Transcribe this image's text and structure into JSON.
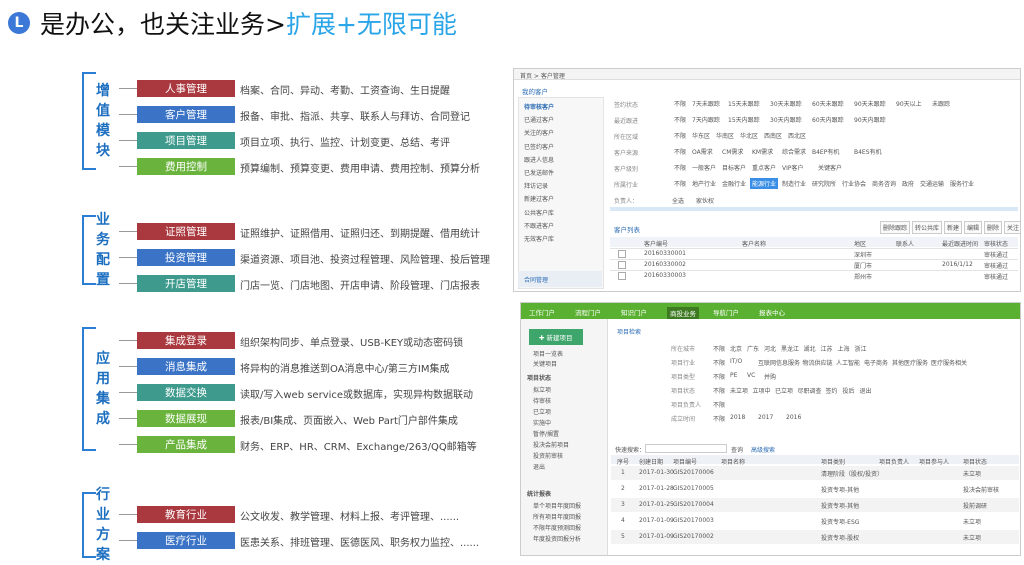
{
  "header": {
    "badge": "L",
    "title_black": "是办公，也关注业务>",
    "title_blue": "扩展+无限可能"
  },
  "groups": [
    {
      "label": "增值模块",
      "items": [
        {
          "tag": "人事管理",
          "color": "c-red",
          "desc": "档案、合同、异动、考勤、工资查询、生日提醒"
        },
        {
          "tag": "客户管理",
          "color": "c-blue",
          "desc": "报备、审批、指派、共享、联系人与拜访、合同登记"
        },
        {
          "tag": "项目管理",
          "color": "c-teal",
          "desc": "项目立项、执行、监控、计划变更、总结、考评"
        },
        {
          "tag": "费用控制",
          "color": "c-green",
          "desc": "预算编制、预算变更、费用申请、费用控制、预算分析"
        }
      ]
    },
    {
      "label": "业务配置",
      "items": [
        {
          "tag": "证照管理",
          "color": "c-red",
          "desc": "证照维护、证照借用、证照归还、到期提醒、借用统计"
        },
        {
          "tag": "投资管理",
          "color": "c-blue",
          "desc": "渠道资源、项目池、投资过程管理、风险管理、投后管理"
        },
        {
          "tag": "开店管理",
          "color": "c-teal",
          "desc": "门店一览、门店地图、开店申请、阶段管理、门店报表"
        }
      ]
    },
    {
      "label": "应用集成",
      "items": [
        {
          "tag": "集成登录",
          "color": "c-red",
          "desc": "组织架构同步、单点登录、USB-KEY或动态密码锁"
        },
        {
          "tag": "消息集成",
          "color": "c-blue",
          "desc": "将异构的消息推送到OA消息中心/第三方IM集成"
        },
        {
          "tag": "数据交换",
          "color": "c-teal",
          "desc": "读取/写入web service或数据库，实现异构数据联动"
        },
        {
          "tag": "数据展现",
          "color": "c-green",
          "desc": "报表/BI集成、页面嵌入、Web Part门户部件集成"
        },
        {
          "tag": "产品集成",
          "color": "c-green",
          "desc": "财务、ERP、HR、CRM、Exchange/263/QQ邮箱等"
        }
      ]
    },
    {
      "label": "行业方案",
      "items": [
        {
          "tag": "教育行业",
          "color": "c-red",
          "desc": "公文收发、教学管理、材料上报、考评管理、......"
        },
        {
          "tag": "医疗行业",
          "color": "c-blue",
          "desc": "医患关系、排班管理、医德医风、职务权力监控、......"
        }
      ]
    }
  ],
  "shot1": {
    "breadcrumb": "首页 > 客户管理",
    "side_title": "我的客户",
    "side_items": [
      "待审核客户",
      "已通过客户",
      "关注的客户",
      "已签约客户",
      "跟进人信息",
      "已发送邮件",
      "拜访记录",
      "新建过客户",
      "公共客户库",
      "不跟进客户",
      "无效客户库"
    ],
    "side_footer": "合同管理",
    "filters": [
      {
        "label": "签约状态",
        "opts": [
          "不限",
          "7天未跟踪",
          "15天未跟踪",
          "30天未跟踪",
          "60天未跟踪",
          "90天未跟踪",
          "90天以上",
          "未跟踪"
        ]
      },
      {
        "label": "最近跟进",
        "opts": [
          "不限",
          "7天内跟踪",
          "15天内跟踪",
          "30天内跟踪",
          "60天内跟踪",
          "90天内跟踪"
        ]
      },
      {
        "label": "所在区域",
        "opts": [
          "不限",
          "华东区",
          "华南区",
          "华北区",
          "西南区",
          "西北区"
        ]
      },
      {
        "label": "客户来源",
        "opts": [
          "不限",
          "OA需求",
          "CM需求",
          "KM需求",
          "综合需求",
          "B4EP有机",
          "B4ES有机"
        ]
      },
      {
        "label": "客户级别",
        "opts": [
          "不限",
          "一般客户",
          "目标客户",
          "重点客户",
          "VIP客户",
          "关键客户"
        ]
      },
      {
        "label": "所属行业",
        "opts": [
          "不限",
          "地产行业",
          "金融行业",
          "能源行业",
          "制造行业",
          "研究院所",
          "行业协会",
          "商务咨询",
          "政府",
          "交通运输",
          "服务行业"
        ]
      }
    ],
    "owner_label": "负责人：",
    "chk1": "全选",
    "chk2": "家伙权",
    "list_title": "客户列表",
    "actions": [
      "删除跟踪",
      "转公共库",
      "新建",
      "编辑",
      "删除",
      "关注"
    ],
    "columns": [
      "",
      "客户编号",
      "客户名称",
      "地区",
      "联系人",
      "最近跟进时间",
      "审核状态"
    ],
    "rows": [
      {
        "id": "20160330001",
        "area": "深圳市",
        "date": "",
        "status": "审核通过"
      },
      {
        "id": "20160330002",
        "area": "厦门市",
        "date": "2016/1/12",
        "status": "审核通过"
      },
      {
        "id": "20160330003",
        "area": "郑州市",
        "date": "",
        "status": "审核通过"
      }
    ]
  },
  "shot2": {
    "tabs": [
      "工作门户",
      "流程门户",
      "知识门户",
      "商投业务",
      "导航门户",
      "报表中心"
    ],
    "new_btn": "✚ 新建项目",
    "side_a": [
      "项目一览表",
      "关键项目"
    ],
    "side_b_title": "项目状态",
    "side_b": [
      "拟立项",
      "待审核",
      "已立项",
      "实施中",
      "暂停/搁置",
      "投决会前项目",
      "投资前审核",
      "退出"
    ],
    "side_c_title": "统计报表",
    "side_c": [
      "单个项目年度回报",
      "所有项目年度回报",
      "不限年度预测回报",
      "年度投资回报分析"
    ],
    "search_title": "项目检索",
    "filters": [
      {
        "label": "所在城市",
        "opts": [
          "不限",
          "北京",
          "广东",
          "河北",
          "黑龙江",
          "湖北",
          "江苏",
          "上海",
          "浙江"
        ]
      },
      {
        "label": "项目行业",
        "opts": [
          "不限",
          "IT/O",
          "互联网信息服务",
          "物流供应链",
          "人工智能",
          "电子商务",
          "其他医疗服务",
          "医疗服务相关"
        ]
      },
      {
        "label": "项目类型",
        "opts": [
          "不限",
          "PE",
          "VC",
          "并购"
        ]
      },
      {
        "label": "项目状态",
        "opts": [
          "不限",
          "未立项",
          "立项中",
          "已立项",
          "尽职调查",
          "签约",
          "投后",
          "退出"
        ]
      },
      {
        "label": "项目负责人",
        "opts": [
          "不限"
        ]
      },
      {
        "label": "成立时间",
        "opts": [
          "不限",
          "2018",
          "2017",
          "2016"
        ]
      }
    ],
    "quick_label": "快速搜索：",
    "query_btn": "查询",
    "adv_btn": "高级搜索",
    "columns": [
      "序号",
      "创建日期",
      "项目编号",
      "项目名称",
      "项目类别",
      "项目负责人",
      "项目参与人",
      "项目状态"
    ],
    "rows": [
      {
        "n": "1",
        "date": "2017-01-30",
        "code": "GIS20170006",
        "cat": "清理阶段（股权/投资）",
        "status": "未立项"
      },
      {
        "n": "2",
        "date": "2017-01-28",
        "code": "GIS20170005",
        "cat": "投资专项-其他",
        "status": "投决会前审核"
      },
      {
        "n": "3",
        "date": "2017-01-25",
        "code": "GIS20170004",
        "cat": "投资专项-其他",
        "status": "投前调研"
      },
      {
        "n": "4",
        "date": "2017-01-09",
        "code": "GIS20170003",
        "cat": "投资专项-ESG",
        "status": "未立项"
      },
      {
        "n": "5",
        "date": "2017-01-09",
        "code": "GIS20170002",
        "cat": "投资专项-股权",
        "status": "未立项"
      }
    ]
  }
}
